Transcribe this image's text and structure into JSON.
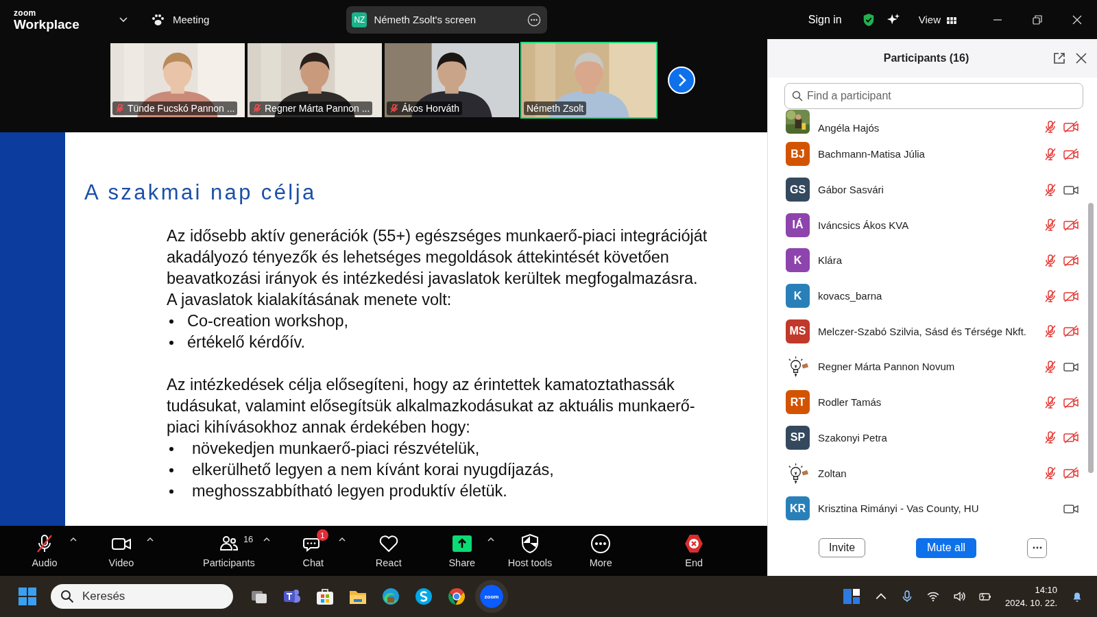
{
  "titlebar": {
    "logo_top": "zoom",
    "logo_bottom": "Workplace",
    "meeting": "Meeting",
    "share_pill": {
      "initials": "NZ",
      "color": "#1bb28b",
      "label": "Németh Zsolt's screen"
    },
    "sign_in": "Sign in",
    "view": "View"
  },
  "thumbnails": [
    {
      "name": "Tünde Fucskó Pannon ...",
      "muted": true,
      "selected": false
    },
    {
      "name": "Regner Márta Pannon ...",
      "muted": true,
      "selected": false
    },
    {
      "name": "Ákos Horváth",
      "muted": true,
      "selected": false
    },
    {
      "name": "Németh Zsolt",
      "muted": false,
      "selected": true
    }
  ],
  "slide": {
    "title": "A szakmai nap célja",
    "blocks": [
      {
        "kind": "para",
        "text": "Az idősebb aktív generációk (55+) egészséges munkaerő-piaci integrációját akadályozó tényezők és lehetséges megoldások áttekintését követően beavatkozási irányok és intézkedési javaslatok kerültek megfogalmazásra."
      },
      {
        "kind": "para",
        "text": "A javaslatok kialakításának menete volt:"
      },
      {
        "kind": "bullet",
        "text": "Co-creation workshop,"
      },
      {
        "kind": "bullet",
        "text": "értékelő kérdőív."
      },
      {
        "kind": "para",
        "text": "Az intézkedések célja elősegíteni, hogy az érintettek kamatoztathassák tudásukat, valamint elősegítsük alkalmazkodásukat az aktuális munkaerő-piaci kihívásokhoz annak érdekében hogy:"
      },
      {
        "kind": "bullet",
        "text": "növekedjen munkaerő-piaci részvételük,"
      },
      {
        "kind": "bullet",
        "text": "elkerülhető legyen a nem kívánt korai nyugdíjazás,"
      },
      {
        "kind": "bullet",
        "text": "meghosszabbítható legyen produktív életük."
      }
    ]
  },
  "toolbar": [
    {
      "kind": "audio",
      "label": "Audio",
      "caret": true,
      "muted": true
    },
    {
      "kind": "video",
      "label": "Video",
      "caret": true
    },
    {
      "kind": "participants",
      "label": "Participants",
      "caret": true,
      "count": "16"
    },
    {
      "kind": "chat",
      "label": "Chat",
      "caret": true,
      "badge": "1"
    },
    {
      "kind": "react",
      "label": "React",
      "caret": false
    },
    {
      "kind": "share",
      "label": "Share",
      "caret": true
    },
    {
      "kind": "host",
      "label": "Host tools",
      "caret": false
    },
    {
      "kind": "more",
      "label": "More",
      "caret": false
    },
    {
      "kind": "end",
      "label": "End",
      "caret": false
    }
  ],
  "participants": {
    "title": "Participants (16)",
    "search": {
      "placeholder": "Find a participant"
    },
    "list": [
      {
        "name": "Angéla Hajós",
        "muted": true,
        "video_off": true
      },
      {
        "name": "Bachmann-Matisa Júlia",
        "kind": "initials",
        "initials": "BJ",
        "color": "#d35400",
        "muted": true,
        "video_off": true
      },
      {
        "name": "Gábor Sasvári",
        "kind": "initials",
        "initials": "GS",
        "color": "#34495e",
        "muted": true,
        "video_off": false
      },
      {
        "name": "Iváncsics Ákos KVA",
        "kind": "initials",
        "initials": "IÁ",
        "color": "#8e44ad",
        "muted": true,
        "video_off": true
      },
      {
        "name": "Klára",
        "kind": "initials",
        "initials": "K",
        "color": "#8e44ad",
        "muted": true,
        "video_off": true
      },
      {
        "name": "kovacs_barna",
        "kind": "initials",
        "initials": "K",
        "color": "#2980b9",
        "muted": true,
        "video_off": true
      },
      {
        "name": "Melczer-Szabó Szilvia, Sásd és Térsége Nkft.",
        "kind": "initials",
        "initials": "MS",
        "color": "#c0392b",
        "muted": true,
        "video_off": true
      },
      {
        "name": "Regner Márta Pannon Novum",
        "kind": "idea",
        "muted": true,
        "video_off": false
      },
      {
        "name": "Rodler Tamás",
        "kind": "initials",
        "initials": "RT",
        "color": "#d35400",
        "muted": true,
        "video_off": true
      },
      {
        "name": "Szakonyi Petra",
        "kind": "initials",
        "initials": "SP",
        "color": "#34495e",
        "muted": true,
        "video_off": true
      },
      {
        "name": "Zoltan",
        "kind": "idea",
        "muted": true,
        "video_off": true
      },
      {
        "name": "Krisztina Rimányi - Vas County, HU",
        "kind": "initials",
        "initials": "KR",
        "color": "#2980b9",
        "muted": false,
        "video_off": false
      }
    ],
    "buttons": [
      "Invite",
      "Mute all"
    ]
  },
  "taskbar": {
    "search": {
      "placeholder": "Keresés"
    },
    "active_app_label": "zoom",
    "time": "14:10",
    "date": "2024. 10. 22."
  }
}
